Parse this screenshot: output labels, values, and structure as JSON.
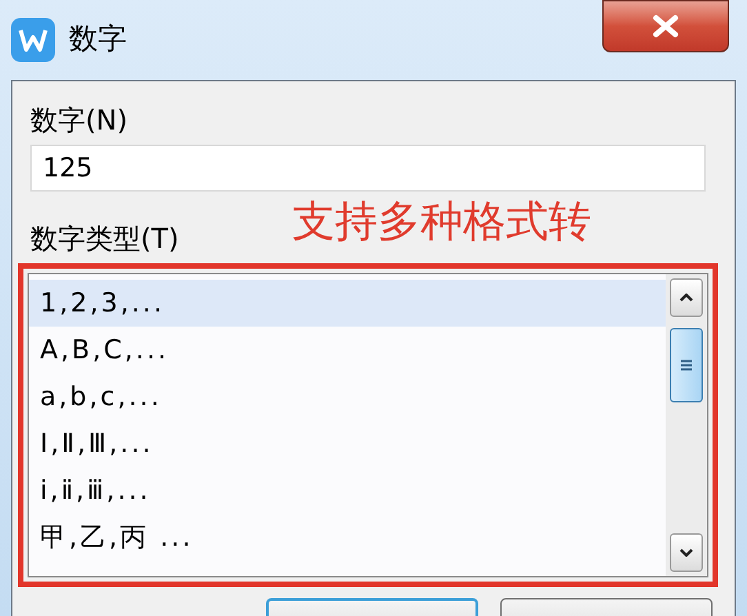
{
  "window": {
    "title": "数字"
  },
  "number_field": {
    "label": "数字(N)",
    "value": "125"
  },
  "type_list": {
    "label": "数字类型(T)",
    "items": [
      {
        "text": "1,2,3,...",
        "selected": true
      },
      {
        "text": "A,B,C,...",
        "selected": false
      },
      {
        "text": "a,b,c,...",
        "selected": false
      },
      {
        "text": "Ⅰ,Ⅱ,Ⅲ,...",
        "selected": false
      },
      {
        "text": "ⅰ,ⅱ,ⅲ,...",
        "selected": false
      },
      {
        "text": "甲,乙,丙 ...",
        "selected": false
      }
    ]
  },
  "annotation": {
    "text": "支持多种格式转"
  },
  "buttons": [
    {
      "default": true
    },
    {
      "default": false
    }
  ]
}
